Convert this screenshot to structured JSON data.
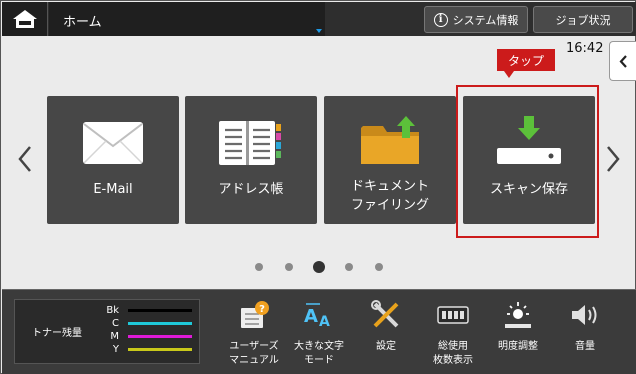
{
  "header": {
    "title": "ホーム",
    "system_info_label": "システム情報",
    "job_status_label": "ジョブ状況"
  },
  "clock": "16:42",
  "tiles": [
    {
      "label_line1": "E-Mail",
      "label_line2": "",
      "icon": "envelope-icon"
    },
    {
      "label_line1": "アドレス帳",
      "label_line2": "",
      "icon": "address-book-icon"
    },
    {
      "label_line1": "ドキュメント",
      "label_line2": "ファイリング",
      "icon": "folder-upload-icon"
    },
    {
      "label_line1": "スキャン保存",
      "label_line2": "",
      "icon": "scan-to-drive-icon"
    }
  ],
  "callout": "タップ",
  "pager": {
    "count": 5,
    "active_index": 2
  },
  "toner": {
    "label": "トナー残量",
    "colors": [
      {
        "code": "Bk",
        "color": "#000000",
        "level": 1.0
      },
      {
        "code": "C",
        "color": "#1fc8d8",
        "level": 1.0
      },
      {
        "code": "M",
        "color": "#e01ad8",
        "level": 1.0
      },
      {
        "code": "Y",
        "color": "#c8c81a",
        "level": 1.0
      }
    ]
  },
  "tools": [
    {
      "label_line1": "ユーザーズ",
      "label_line2": "マニュアル",
      "icon": "manual-icon"
    },
    {
      "label_line1": "大きな文字",
      "label_line2": "モード",
      "icon": "large-text-icon"
    },
    {
      "label_line1": "設定",
      "label_line2": "",
      "icon": "settings-tools-icon"
    },
    {
      "label_line1": "総使用",
      "label_line2": "枚数表示",
      "icon": "counter-icon"
    },
    {
      "label_line1": "明度調整",
      "label_line2": "",
      "icon": "brightness-icon"
    },
    {
      "label_line1": "音量",
      "label_line2": "",
      "icon": "volume-icon"
    }
  ]
}
